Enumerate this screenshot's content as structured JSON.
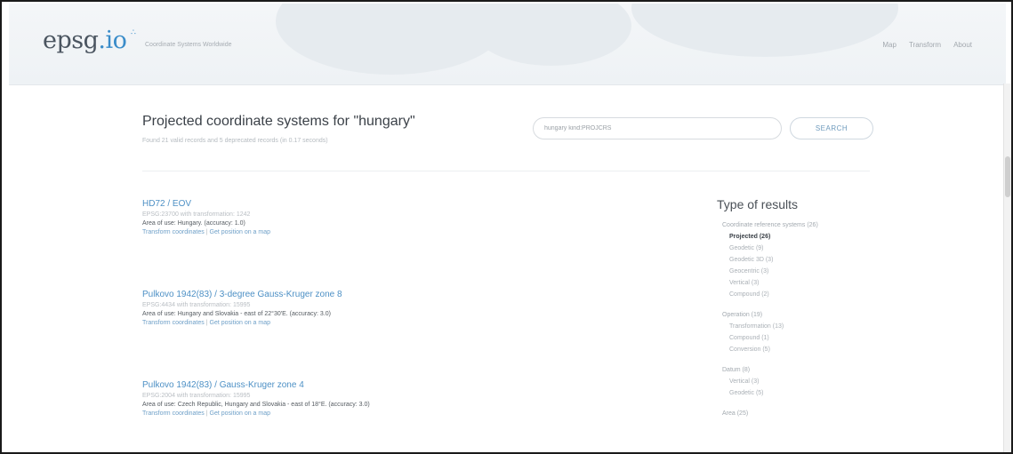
{
  "header": {
    "logo": {
      "main": "epsg",
      "accent": ".io"
    },
    "tagline": "Coordinate Systems Worldwide",
    "nav": [
      {
        "label": "Map"
      },
      {
        "label": "Transform"
      },
      {
        "label": "About"
      }
    ]
  },
  "search": {
    "title": "Projected coordinate systems for \"hungary\"",
    "stats": "Found 21 valid records and 5 deprecated records (in 0.17 seconds)",
    "input_value": "hungary kind:PROJCRS",
    "button_label": "SEARCH"
  },
  "results": [
    {
      "title": "HD72 / EOV",
      "meta": "EPSG:23700 with transformation: 1242",
      "area": "Area of use: Hungary. (accuracy: 1.0)",
      "link_transform": "Transform coordinates",
      "separator": "|",
      "link_map": "Get position on a map"
    },
    {
      "title": "Pulkovo 1942(83) / 3-degree Gauss-Kruger zone 8",
      "meta": "EPSG:4434 with transformation: 15995",
      "area": "Area of use: Hungary and Slovakia - east of 22°30'E. (accuracy: 3.0)",
      "link_transform": "Transform coordinates",
      "separator": "|",
      "link_map": "Get position on a map"
    },
    {
      "title": "Pulkovo 1942(83) / Gauss-Kruger zone 4",
      "meta": "EPSG:2004 with transformation: 15995",
      "area": "Area of use: Czech Republic, Hungary and Slovakia - east of 18°E. (accuracy: 3.0)",
      "link_transform": "Transform coordinates",
      "separator": "|",
      "link_map": "Get position on a map"
    }
  ],
  "facets": {
    "title": "Type of results",
    "groups": [
      {
        "head": "Coordinate reference systems (26)",
        "items": [
          {
            "label": "Projected (26)",
            "active": true
          },
          {
            "label": "Geodetic (9)",
            "active": false
          },
          {
            "label": "Geodetic 3D (3)",
            "active": false
          },
          {
            "label": "Geocentric (3)",
            "active": false
          },
          {
            "label": "Vertical (3)",
            "active": false
          },
          {
            "label": "Compound (2)",
            "active": false
          }
        ]
      },
      {
        "head": "Operation (19)",
        "items": [
          {
            "label": "Transformation (13)",
            "active": false
          },
          {
            "label": "Compound (1)",
            "active": false
          },
          {
            "label": "Conversion (5)",
            "active": false
          }
        ]
      },
      {
        "head": "Datum (8)",
        "items": [
          {
            "label": "Vertical (3)",
            "active": false
          },
          {
            "label": "Geodetic (5)",
            "active": false
          }
        ]
      },
      {
        "head": "Area (25)",
        "items": []
      }
    ]
  },
  "colors": {
    "link": "#4d90c5",
    "text_dark": "#3b4148",
    "text_muted": "#b5bbc0",
    "accent": "#3a8cc9"
  }
}
